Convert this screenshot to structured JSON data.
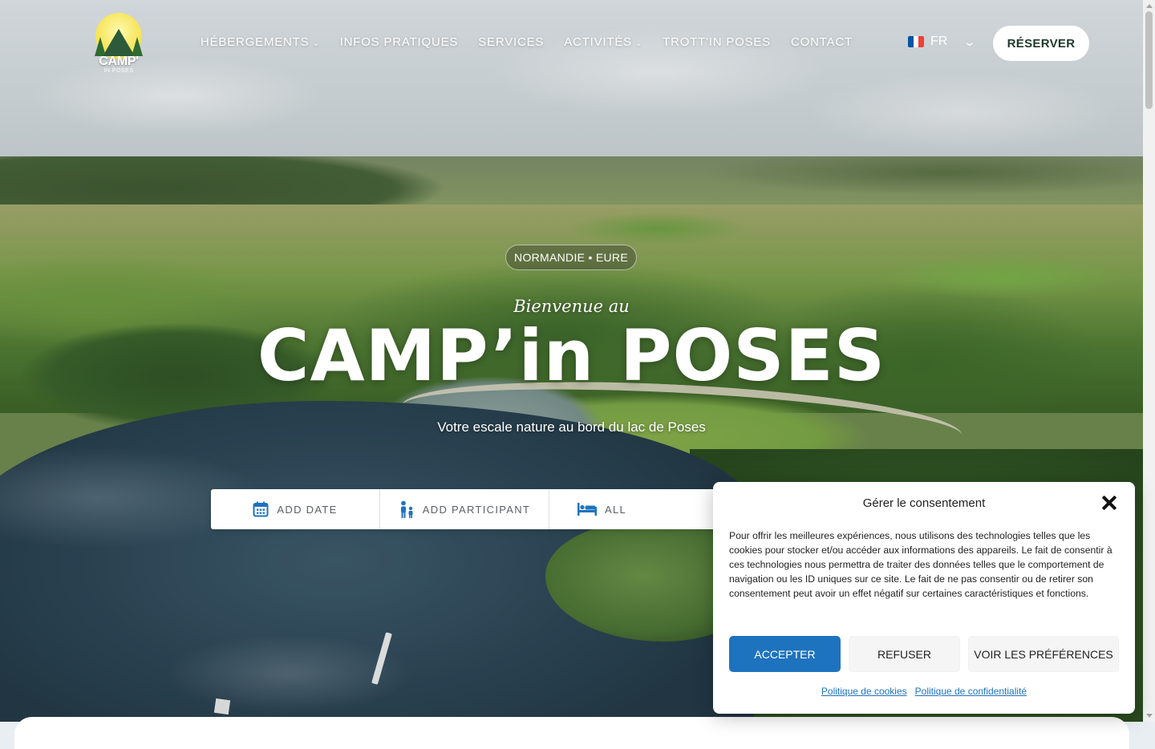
{
  "brand": {
    "logo_word": "CAMP'",
    "logo_sub": "IN POSES"
  },
  "nav": {
    "items": [
      {
        "label": "HÉBERGEMENTS",
        "has_dropdown": true
      },
      {
        "label": "INFOS PRATIQUES",
        "has_dropdown": false
      },
      {
        "label": "SERVICES",
        "has_dropdown": false
      },
      {
        "label": "ACTIVITÉS",
        "has_dropdown": true
      },
      {
        "label": "TROTT'IN POSES",
        "has_dropdown": false
      },
      {
        "label": "CONTACT",
        "has_dropdown": false
      }
    ],
    "dropdown_glyph": "⌄"
  },
  "language": {
    "code": "FR",
    "flag_colors": [
      "#0055a4",
      "#ffffff",
      "#ef4135"
    ]
  },
  "reserve_label": "RÉSERVER",
  "hero": {
    "badge": "NORMANDIE • EURE",
    "welcome": "Bienvenue au",
    "title": "CAMP’in POSES",
    "tagline": "Votre escale nature au bord du lac de Poses"
  },
  "search": {
    "date_label": "ADD DATE",
    "participant_label": "ADD PARTICIPANT",
    "accommodation_label": "ALL",
    "icon_color": "#1e73be"
  },
  "consent": {
    "title": "Gérer le consentement",
    "body": "Pour offrir les meilleures expériences, nous utilisons des technologies telles que les cookies pour stocker et/ou accéder aux informations des appareils. Le fait de consentir à ces technologies nous permettra de traiter des données telles que le comportement de navigation ou les ID uniques sur ce site. Le fait de ne pas consentir ou de retirer son consentement peut avoir un effet négatif sur certaines caractéristiques et fonctions.",
    "accept": "ACCEPTER",
    "refuse": "REFUSER",
    "preferences": "VOIR LES PRÉFÉRENCES",
    "cookie_policy": "Politique de cookies",
    "privacy_policy": "Politique de confidentialité",
    "accent_color": "#1e73be"
  }
}
